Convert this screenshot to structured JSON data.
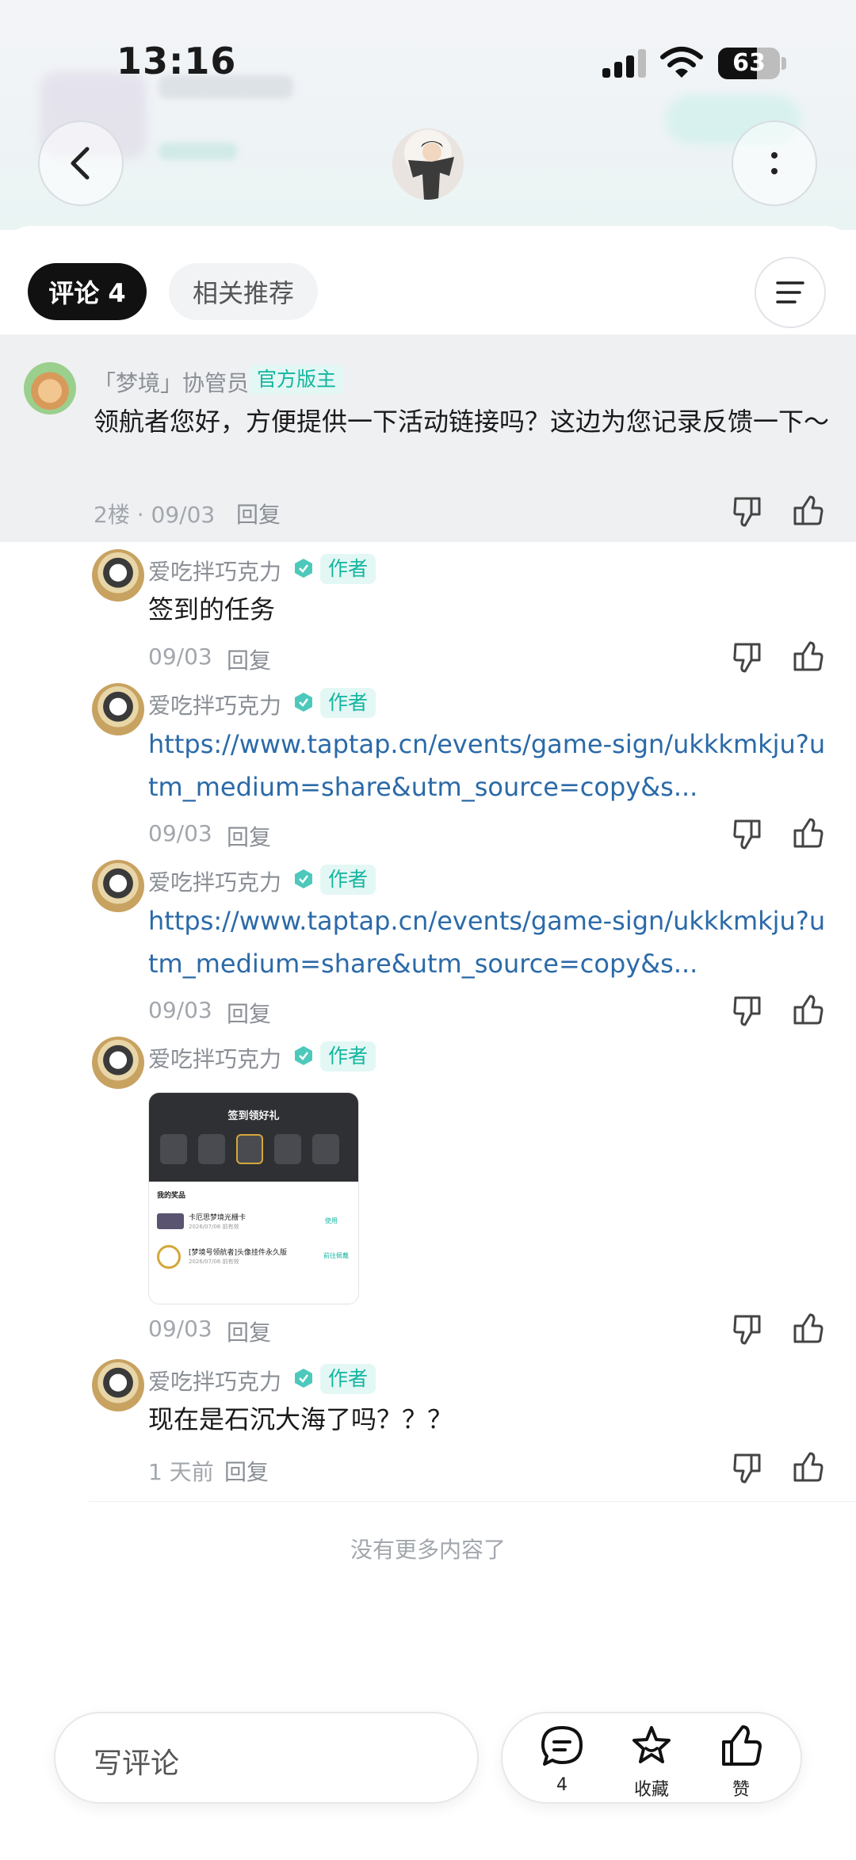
{
  "status_bar": {
    "time": "13:16",
    "battery": "63",
    "battery_level": 0.63
  },
  "header": {
    "back_icon": "chevron-left-icon",
    "more_icon": "more-vertical-icon"
  },
  "tabs": [
    {
      "label": "评论 4",
      "active": true
    },
    {
      "label": "相关推荐",
      "active": false
    }
  ],
  "main_comment": {
    "author": "「梦境」协管员",
    "badge": "官方版主",
    "text": "领航者您好，方便提供一下活动链接吗？这边为您记录反馈一下～",
    "meta": "2楼 · 09/03",
    "reply": "回复"
  },
  "replies": [
    {
      "author": "爱吃拌巧克力",
      "badge": "作者",
      "text": "签到的任务",
      "date": "09/03",
      "reply": "回复"
    },
    {
      "author": "爱吃拌巧克力",
      "badge": "作者",
      "link": "https://www.taptap.cn/events/game-sign/ukkkmkju?utm_medium=share&utm_source=copy&s...",
      "date": "09/03",
      "reply": "回复"
    },
    {
      "author": "爱吃拌巧克力",
      "badge": "作者",
      "link": "https://www.taptap.cn/events/game-sign/ukkkmkju?utm_medium=share&utm_source=copy&s...",
      "date": "09/03",
      "reply": "回复"
    },
    {
      "author": "爱吃拌巧克力",
      "badge": "作者",
      "date": "09/03",
      "reply": "回复",
      "image": {
        "title": "签到领好礼",
        "section": "我的奖品",
        "item1": "卡厄思梦境光栅卡",
        "item1_date": "2026/07/06 前有效",
        "item1_action": "使用",
        "item2": "[梦境号领航者]头像挂件永久版",
        "item2_date": "2026/07/06 前有效",
        "item2_action": "前往佩戴"
      }
    },
    {
      "author": "爱吃拌巧克力",
      "badge": "作者",
      "text": "现在是石沉大海了吗？？？",
      "date": "1 天前",
      "reply": "回复"
    }
  ],
  "end_text": "没有更多内容了",
  "bottom_bar": {
    "comment_placeholder": "写评论",
    "comment_count": "4",
    "collect_label": "收藏",
    "like_label": "赞"
  },
  "colors": {
    "accent": "#14b5a0",
    "link": "#2b6aa8",
    "badge_bg": "#e3f7f4"
  }
}
